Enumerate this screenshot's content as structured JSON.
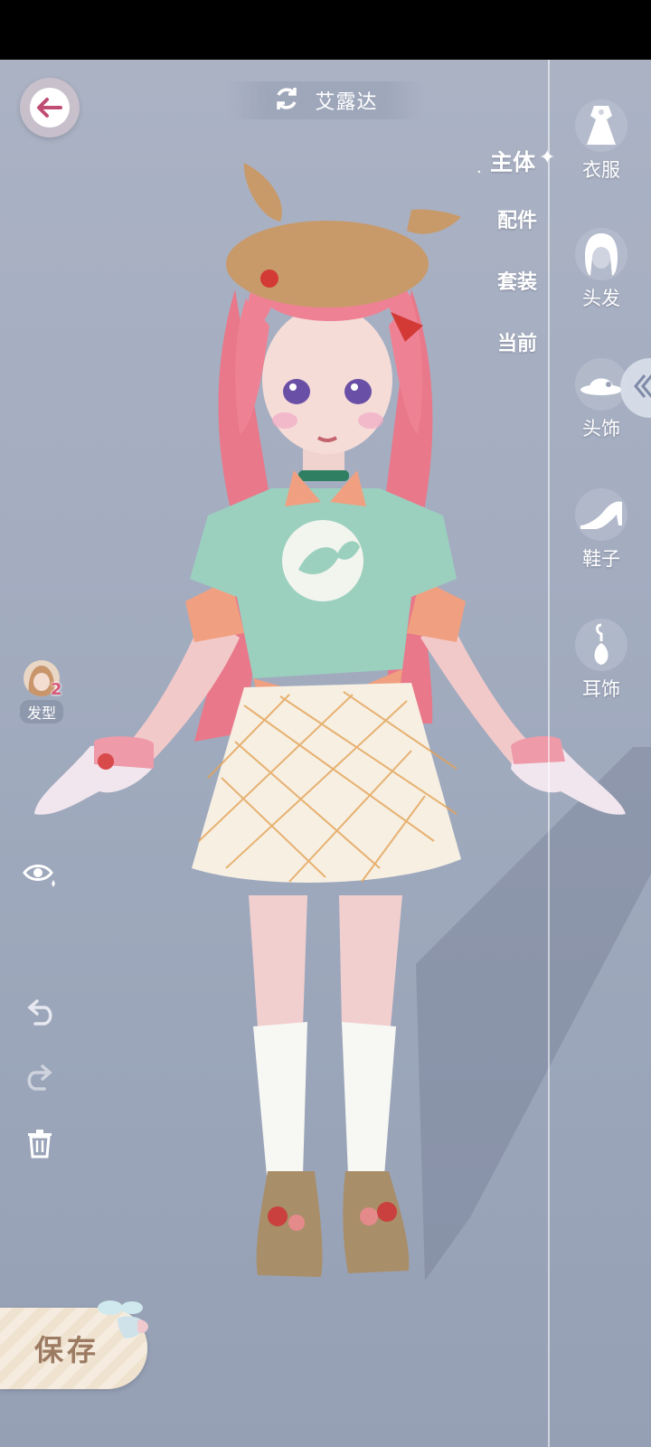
{
  "header": {
    "character_name": "艾露达"
  },
  "category_tabs": [
    {
      "label": "主体",
      "active": true
    },
    {
      "label": "配件",
      "active": false
    },
    {
      "label": "套装",
      "active": false
    },
    {
      "label": "当前",
      "active": false
    }
  ],
  "right_rail": [
    {
      "label": "衣服",
      "icon": "dress-icon"
    },
    {
      "label": "头发",
      "icon": "hair-icon"
    },
    {
      "label": "头饰",
      "icon": "hat-icon"
    },
    {
      "label": "鞋子",
      "icon": "high-heel-icon"
    },
    {
      "label": "耳饰",
      "icon": "earring-icon"
    }
  ],
  "left_tools": {
    "hair_chip": {
      "label": "发型",
      "badge": "2"
    }
  },
  "save": {
    "label": "保存"
  },
  "colors": {
    "background": "#a4adc0",
    "accent_text": "#ffffff",
    "save_text": "#9c7b62",
    "hair_badge": "#d85a7a"
  }
}
